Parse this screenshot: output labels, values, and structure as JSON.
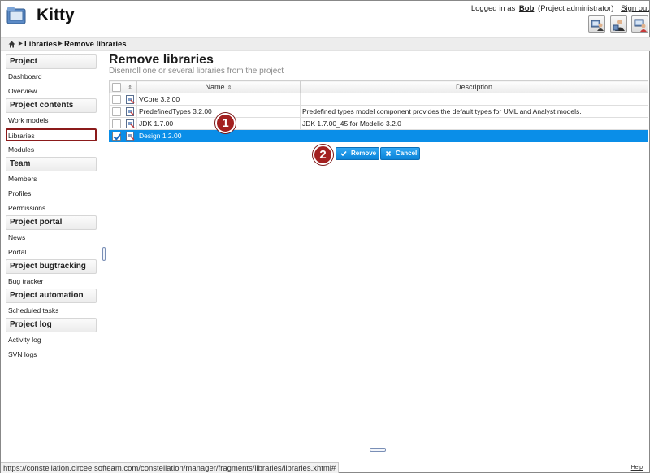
{
  "app": {
    "title": "Kitty",
    "icon": "folder-monitor-icon"
  },
  "header": {
    "logged_in_prefix": "Logged in as",
    "username": "Bob",
    "role": "(Project administrator)",
    "sign_out": "Sign out",
    "buttons": [
      {
        "icon": "user-admin-icon"
      },
      {
        "icon": "user-settings-icon"
      },
      {
        "icon": "user-monitor-icon"
      }
    ]
  },
  "breadcrumb": {
    "home_icon": "home-icon",
    "items": [
      "Libraries",
      "Remove libraries"
    ]
  },
  "sidebar": {
    "groups": [
      {
        "title": "Project",
        "items": [
          "Dashboard",
          "Overview"
        ]
      },
      {
        "title": "Project contents",
        "items": [
          "Work models",
          "Libraries",
          "Modules"
        ]
      },
      {
        "title": "Team",
        "items": [
          "Members",
          "Profiles",
          "Permissions"
        ]
      },
      {
        "title": "Project portal",
        "items": [
          "News",
          "Portal"
        ]
      },
      {
        "title": "Project bugtracking",
        "items": [
          "Bug tracker"
        ]
      },
      {
        "title": "Project automation",
        "items": [
          "Scheduled tasks"
        ]
      },
      {
        "title": "Project log",
        "items": [
          "Activity log",
          "SVN logs"
        ]
      }
    ],
    "selected": "Libraries"
  },
  "main": {
    "title": "Remove libraries",
    "subtitle": "Disenroll one or several libraries from the project",
    "columns": {
      "name": "Name",
      "description": "Description"
    },
    "rows": [
      {
        "name": "VCore 3.2.00",
        "description": "",
        "checked": false
      },
      {
        "name": "PredefinedTypes 3.2.00",
        "description": "Predefined types model component provides the default types for UML and Analyst models.",
        "checked": false
      },
      {
        "name": "JDK 1.7.00",
        "description": "JDK 1.7.00_45 for Modelio 3.2.0",
        "checked": false
      },
      {
        "name": "Design 1.2.00",
        "description": "",
        "checked": true
      }
    ],
    "callouts": [
      "1",
      "2"
    ],
    "remove_label": "Remove",
    "cancel_label": "Cancel"
  },
  "footer": {
    "status_url": "https://constellation.circee.softeam.com/constellation/manager/fragments/libraries/libraries.xhtml#",
    "help": "Help"
  },
  "colors": {
    "selection": "#0a8ee8",
    "callout": "#a32020",
    "button": "#0b84d8"
  }
}
